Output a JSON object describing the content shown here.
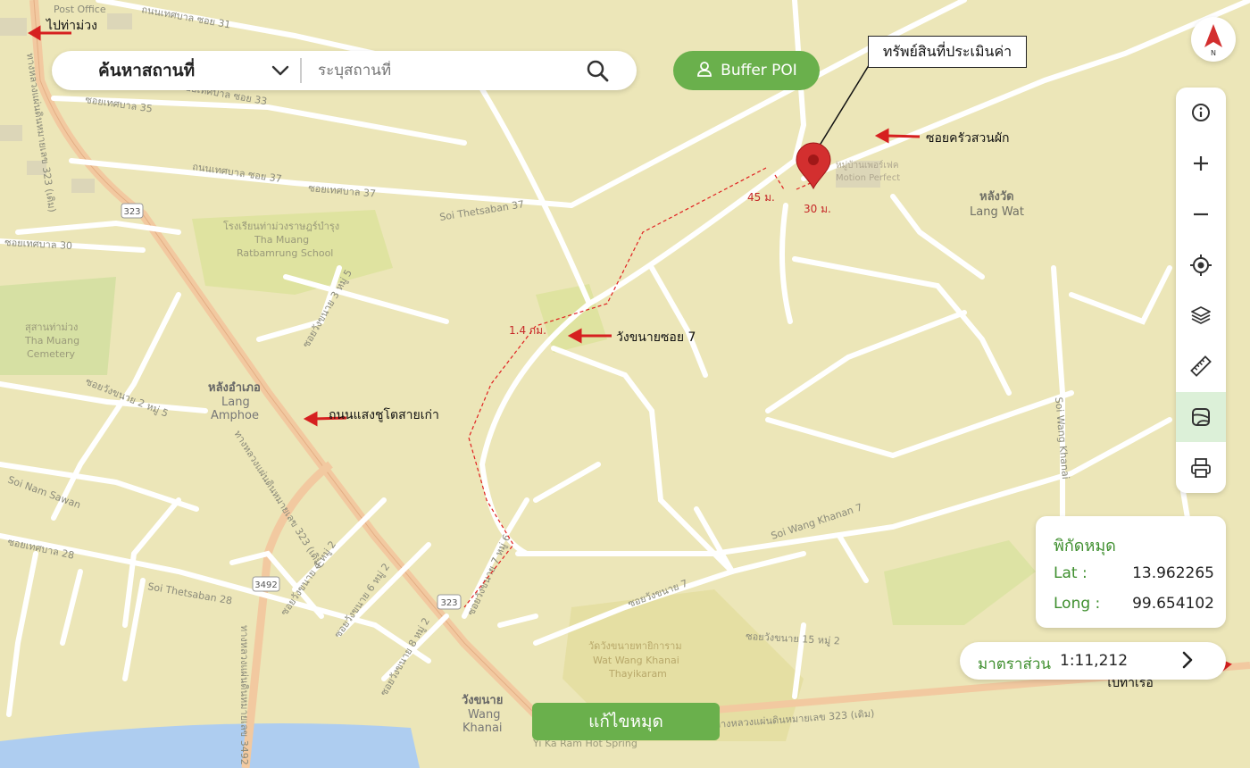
{
  "search": {
    "category": "ค้นหาสถานที่",
    "placeholder": "ระบุสถานที่",
    "value": ""
  },
  "buffer_button": {
    "label": "Buffer POI",
    "icon": "user-icon"
  },
  "compass": {
    "letter": "N",
    "icon": "north-arrow-icon"
  },
  "toolbar": {
    "tools": [
      {
        "name": "info",
        "icon": "info-icon"
      },
      {
        "name": "zoom-in",
        "icon": "plus-icon"
      },
      {
        "name": "zoom-out",
        "icon": "minus-icon"
      },
      {
        "name": "locate",
        "icon": "crosshair-icon"
      },
      {
        "name": "layers",
        "icon": "layers-icon"
      },
      {
        "name": "measure",
        "icon": "ruler-icon"
      },
      {
        "name": "basemap",
        "icon": "map-frame-icon",
        "active": true
      },
      {
        "name": "print",
        "icon": "printer-icon"
      }
    ]
  },
  "coordinates": {
    "title": "พิกัดหมุด",
    "lat_label": "Lat :",
    "lat_value": "13.962265",
    "long_label": "Long :",
    "long_value": "99.654102"
  },
  "scale": {
    "label": "มาตราส่วน",
    "value": "1:11,212"
  },
  "edit_pin_button": "แก้ไขหมุด",
  "annotations": {
    "property_callout": "ทรัพย์สินที่ประเมินค่า",
    "to_tha_muang": "ไปท่าม่วง",
    "soi_khrua_suan_phak": "ซอยครัวสวนผัก",
    "wang_khanai_soi_7": "วังขนายซอย 7",
    "old_saeng_chuto_road": "ถนนแสงชูโตสายเก่า",
    "to_tha_ruea": "ไปท่าเรือ",
    "dist_45": "45 ม.",
    "dist_30": "30 ม.",
    "dist_1_4": "1.4 กม."
  },
  "map_labels": {
    "post_office": "Post Office",
    "lang_wat_th": "หลังวัด",
    "lang_wat_en": "Lang Wat",
    "lang_amphoe_th": "หลังอำเภอ",
    "lang_amphoe_en1": "Lang",
    "lang_amphoe_en2": "Amphoe",
    "wang_khanai_th": "วังขนาย",
    "wang_khanai_en1": "Wang",
    "wang_khanai_en2": "Khanai",
    "school_th": "โรงเรียนท่าม่วงราษฎร์บำรุง",
    "school_en1": "Tha Muang",
    "school_en2": "Ratbamrung School",
    "cemetery_th": "สุสานท่าม่วง",
    "cemetery_en1": "Tha Muang",
    "cemetery_en2": "Cemetery",
    "temple_th": "วัดวังขนายทายิการาม",
    "temple_en1": "Wat Wang Khanai",
    "temple_en2": "Thayikaram",
    "village_th": "หมู่บ้านเพอร์เฟค",
    "village_en": "Motion Perfect",
    "soi_thetsaban_37": "Soi Thetsaban 37",
    "soi_thetsaban_28": "Soi Thetsaban 28",
    "soi_wang_khanan_7": "Soi Wang Khanan 7",
    "soi_wang_khanai": "Soi Wang Khanai",
    "soi_nam_sawan": "Soi Nam Sawan",
    "hot_spring": "Yi Ka Ram Hot Spring",
    "road_323": "323",
    "road_3492": "3492",
    "thai_soi_31": "ถนนเทศบาล ซอย 31",
    "thai_soi_33": "ซอยเทศบาล ซอย 33",
    "thai_soi_35": "ซอยเทศบาล 35",
    "thai_soi_37": "ถนนเทศบาล ซอย 37",
    "thai_soi_37b": "ซอยเทศบาล 37",
    "thai_soi_30": "ซอยเทศบาล 30",
    "thai_soi_28": "ซอยเทศบาล 28",
    "thai_wangkhanai_2": "ซอยวังขนาย 2 หมู่ 5",
    "thai_wangkhanai_3": "ซอยวังขนาย 3 หมู่ 5",
    "thai_wangkhanai_4": "ซอยวังขนาย 4 หมู่ 2",
    "thai_wangkhanai_6": "ซอยวังขนาย 6 หมู่ 2",
    "thai_wangkhanai_7": "ซอยวังขนาย 7 หมู่ 6",
    "thai_wangkhanai_8": "ซอยวังขนาย 8 หมู่ 2",
    "thai_wangkhanai_soi7": "ซอยวังขนาย 7",
    "thai_wangkhanai_15": "ซอยวังขนาย 15 หมู่ 2",
    "thai_hwy_323_a": "ทางหลวงแผ่นดินหมายเลข 323 (เดิม)",
    "thai_hwy_323_b": "ทางหลวงแผ่นดินหมายเลข 323 (เดิม)",
    "thai_hwy_323_c": "ทางหลวงแผ่นดินหมายเลข 323 (เดิม)",
    "thai_hwy_3492": "ทางหลวงแผ่นดินหมายเลข 3492"
  },
  "colors": {
    "map_bg": "#ece6b8",
    "road": "#ffffff",
    "highway": "#f2c9a0",
    "green_area": "#dfe3a0",
    "water": "#aecdf0",
    "accent_green": "#6ab04c",
    "marker_red": "#d32f2f",
    "annotation_red": "#d62020"
  }
}
